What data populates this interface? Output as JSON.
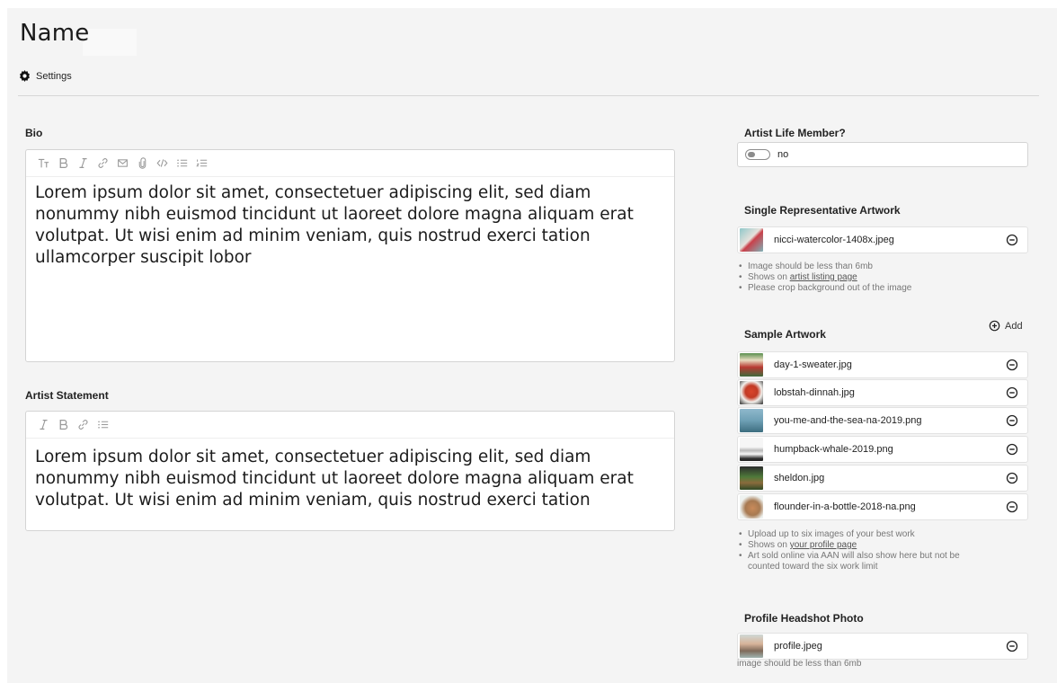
{
  "header": {
    "title": "Name",
    "settings_label": "Settings"
  },
  "bio": {
    "label": "Bio",
    "text": "Lorem ipsum dolor sit amet, consectetuer adipiscing elit, sed diam nonummy nibh euismod tincidunt ut laoreet dolore magna aliquam erat volutpat. Ut wisi enim ad minim veniam, quis nostrud exerci tation ullamcorper suscipit lobor"
  },
  "statement": {
    "label": "Artist Statement",
    "text": "Lorem ipsum dolor sit amet, consectetuer adipiscing elit, sed diam nonummy nibh euismod tincidunt ut laoreet dolore magna aliquam erat volutpat. Ut wisi enim ad minim veniam, quis nostrud exerci tation"
  },
  "life_member": {
    "label": "Artist Life Member?",
    "value": "no"
  },
  "representative": {
    "label": "Single Representative Artwork",
    "file": "nicci-watercolor-1408x.jpeg",
    "hints": {
      "h1": "Image should be less than 6mb",
      "h2_prefix": "Shows on ",
      "h2_link": "artist listing page",
      "h3": "Please crop background out of the image"
    }
  },
  "samples": {
    "label": "Sample Artwork",
    "add_label": "Add",
    "files": [
      "day-1-sweater.jpg",
      "lobstah-dinnah.jpg",
      "you-me-and-the-sea-na-2019.png",
      "humpback-whale-2019.png",
      "sheldon.jpg",
      "flounder-in-a-bottle-2018-na.png"
    ],
    "hints": {
      "h1": "Upload up to six images of your best work",
      "h2_prefix": "Shows on ",
      "h2_link": "your profile page",
      "h3a": "Art sold online via AAN will also show here but not be",
      "h3b": "counted toward the six work limit"
    }
  },
  "headshot": {
    "label": "Profile Headshot Photo",
    "file": "profile.jpeg",
    "note": "image should be less than 6mb"
  }
}
